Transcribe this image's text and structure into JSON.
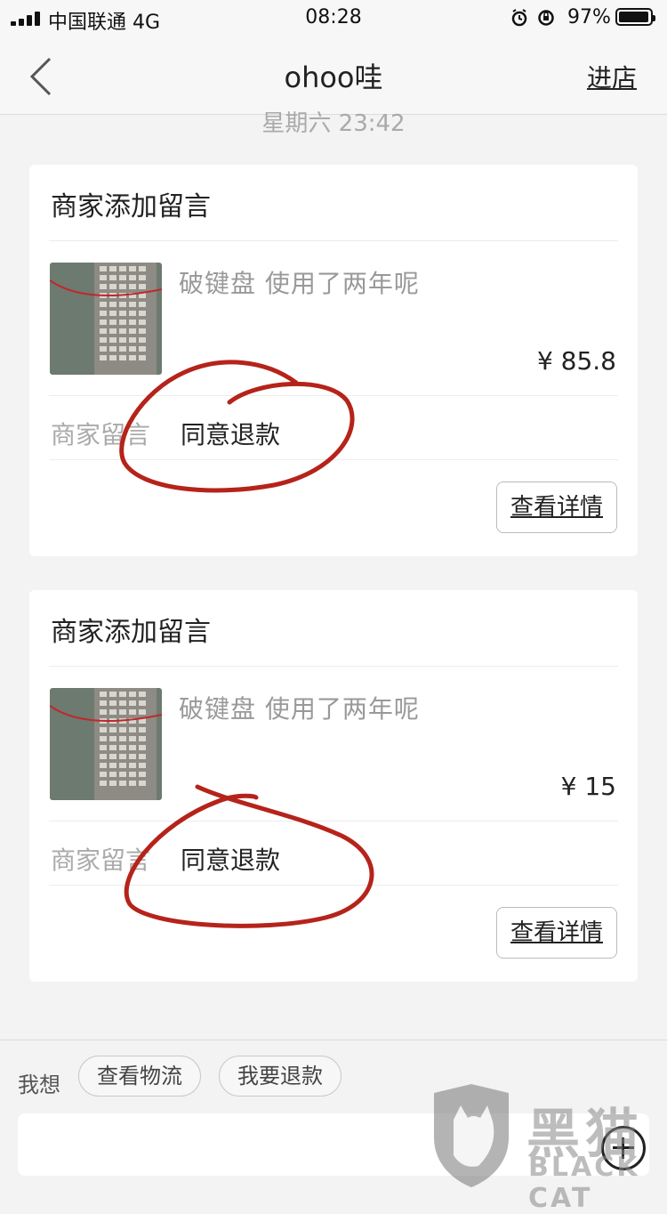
{
  "status_bar": {
    "carrier": "中国联通",
    "network": "4G",
    "time": "08:28",
    "battery_percent": "97%"
  },
  "nav": {
    "title": "ohoo哇",
    "action_label": "进店"
  },
  "timestamp_top": "星期六 23:42",
  "cards": [
    {
      "title": "商家添加留言",
      "product_name": "破键盘  使用了两年呢",
      "price": "¥ 85.8",
      "note_label": "商家留言",
      "note_value": "同意退款",
      "details_label": "查看详情"
    },
    {
      "title": "商家添加留言",
      "product_name": "破键盘  使用了两年呢",
      "price": "¥ 15",
      "note_label": "商家留言",
      "note_value": "同意退款",
      "details_label": "查看详情"
    }
  ],
  "bottom_bar": {
    "quick_label": "我想",
    "chips": [
      "查看物流",
      "我要退款"
    ]
  },
  "watermark": {
    "cn": "黑猫",
    "en": "BLACK CAT"
  },
  "colors": {
    "annotation_red": "#b5231a",
    "background": "#f3f3f3",
    "card": "#ffffff"
  }
}
